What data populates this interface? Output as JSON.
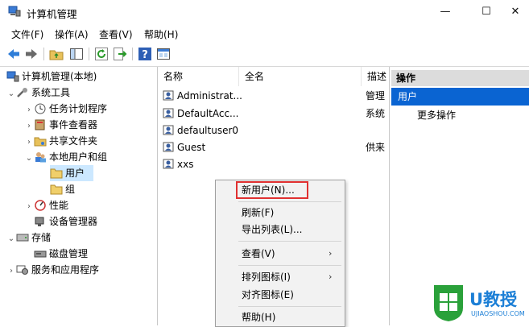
{
  "window": {
    "title": "计算机管理",
    "minimize_glyph": "—",
    "maximize_glyph": "☐",
    "close_glyph": "✕"
  },
  "menu": [
    "文件(F)",
    "操作(A)",
    "查看(V)",
    "帮助(H)"
  ],
  "toolbar_icons": [
    "back-arrow-icon",
    "forward-arrow-icon",
    "up-folder-icon",
    "show-hide-tree-icon",
    "refresh-icon",
    "export-list-icon",
    "help-icon",
    "properties-icon"
  ],
  "tree": {
    "root": "计算机管理(本地)",
    "system_tools": "系统工具",
    "task_scheduler": "任务计划程序",
    "event_viewer": "事件查看器",
    "shared_folders": "共享文件夹",
    "local_users_groups": "本地用户和组",
    "users": "用户",
    "groups": "组",
    "performance": "性能",
    "device_manager": "设备管理器",
    "storage": "存储",
    "disk_management": "磁盘管理",
    "services_apps": "服务和应用程序",
    "caret_open": "⌄",
    "caret_closed": "›"
  },
  "list": {
    "columns": {
      "name": "名称",
      "fullname": "全名",
      "desc": "描述"
    },
    "rows": [
      {
        "name": "Administrat...",
        "desc": "管理"
      },
      {
        "name": "DefaultAcc...",
        "desc": "系统"
      },
      {
        "name": "defaultuser0",
        "desc": ""
      },
      {
        "name": "Guest",
        "desc": "供来"
      },
      {
        "name": "xxs",
        "desc": ""
      }
    ]
  },
  "actions": {
    "header": "操作",
    "selected": "用户",
    "more": "更多操作"
  },
  "context_menu": {
    "new_user": "新用户(N)...",
    "refresh": "刷新(F)",
    "export_list": "导出列表(L)...",
    "view": "查看(V)",
    "arrange_icons": "排列图标(I)",
    "align_icons": "对齐图标(E)",
    "help": "帮助(H)",
    "submenu_arrow": "›"
  },
  "watermark": {
    "brand": "U教授",
    "url": "UJIAOSHOU.COM"
  }
}
